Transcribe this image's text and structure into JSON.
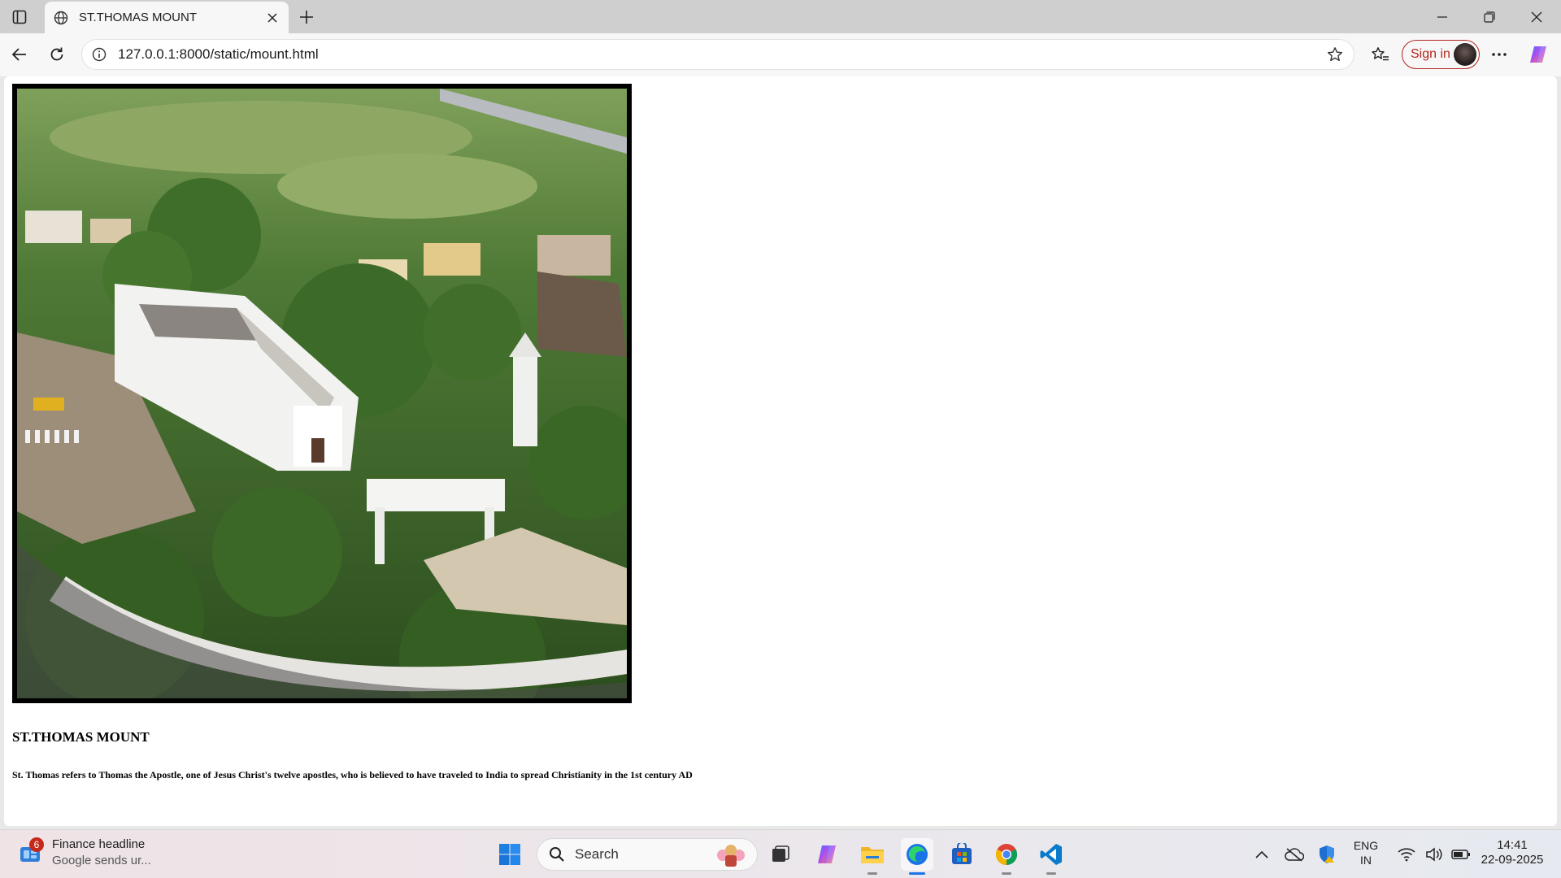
{
  "browser": {
    "tab_title": "ST.THOMAS MOUNT",
    "url": "127.0.0.1:8000/static/mount.html",
    "signin_label": "Sign in"
  },
  "page": {
    "heading": "ST.THOMAS MOUNT",
    "paragraph": "St. Thomas refers to Thomas the Apostle, one of Jesus Christ's twelve apostles, who is believed to have traveled to India to spread Christianity in the 1st century AD"
  },
  "taskbar": {
    "widget_badge": "6",
    "widget_title": "Finance headline",
    "widget_subtitle": "Google sends ur...",
    "search_label": "Search",
    "language": "ENG",
    "region": "IN",
    "time": "14:41",
    "date": "22-09-2025"
  },
  "colors": {
    "signin_accent": "#b3261e",
    "edge_blue": "#1a73e8",
    "vscode_blue": "#0a7acc"
  }
}
